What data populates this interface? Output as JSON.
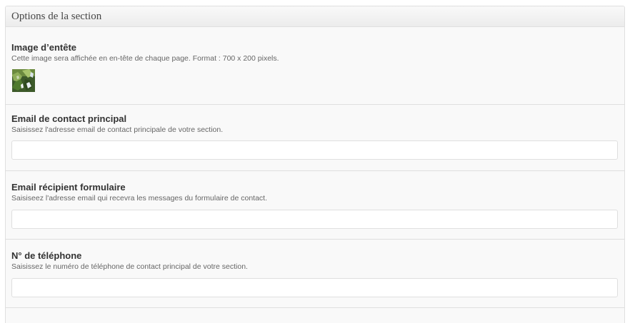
{
  "section": {
    "title": "Options de la section"
  },
  "fields": {
    "header_image": {
      "label": "Image d’entête",
      "description": "Cette image sera affichée en en-tête de chaque page. Format : 700 x 200 pixels.",
      "thumbnail_icon": "image-thumbnail-icon"
    },
    "main_email": {
      "label": "Email de contact principal",
      "description": "Saisissez l'adresse email de contact principale de votre section.",
      "value": "",
      "placeholder": ""
    },
    "form_recipient_email": {
      "label": "Email récipient formulaire",
      "description": "Saisiseez l'adresse email qui recevra les messages du formulaire de contact.",
      "value": "",
      "placeholder": ""
    },
    "phone": {
      "label": "N° de téléphone",
      "description": "Saisissez le numéro de téléphone de contact principal de votre section.",
      "value": "",
      "placeholder": ""
    }
  },
  "colors": {
    "panel_background": "#f9f9f9",
    "border": "#dfdfdf",
    "label_text": "#333333",
    "description_text": "#666666"
  }
}
